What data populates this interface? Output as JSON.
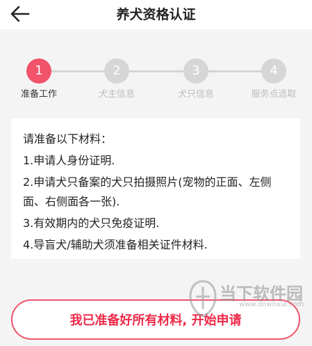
{
  "header": {
    "title": "养犬资格认证",
    "back_icon": "arrow-left-icon"
  },
  "steps": [
    {
      "number": "1",
      "label": "准备工作",
      "active": true
    },
    {
      "number": "2",
      "label": "犬主信息",
      "active": false
    },
    {
      "number": "3",
      "label": "犬只信息",
      "active": false
    },
    {
      "number": "4",
      "label": "服务点选取",
      "active": false
    }
  ],
  "materials": {
    "heading": "请准备以下材料：",
    "items": [
      "1.申请人身份证明.",
      "2.申请犬只备案的犬只拍摄照片(宠物的正面、左侧面、右侧面各一张).",
      "3.有效期内的犬只免疫证明.",
      "4.导盲犬/辅助犬须准备相关证件材料."
    ]
  },
  "cta": {
    "label": "我已准备好所有材料, 开始申请"
  },
  "watermark": {
    "text": "当下软件园",
    "url": "www.downxia.com"
  },
  "colors": {
    "accent": "#f0536a",
    "inactive": "#d6d6d6",
    "background": "#f4f4f4"
  }
}
